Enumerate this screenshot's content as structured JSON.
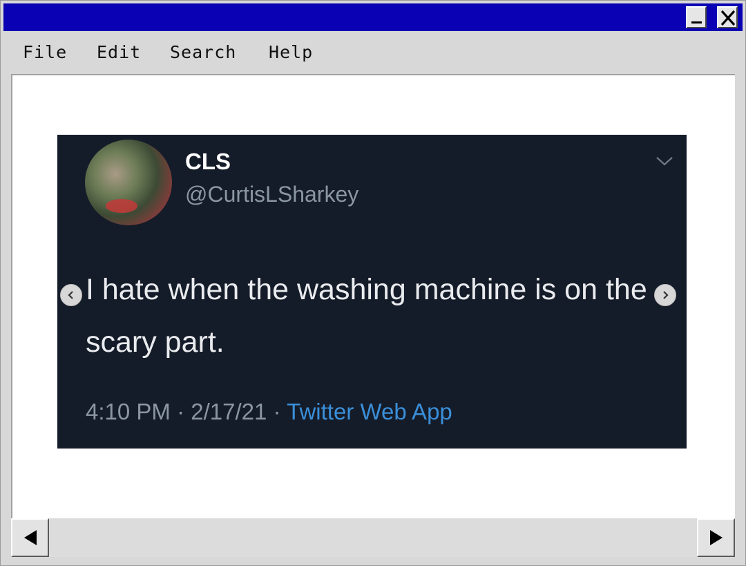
{
  "window": {
    "buttons": {
      "minimize_icon": "minimize-icon",
      "close_icon": "close-icon"
    }
  },
  "menu": {
    "items": [
      {
        "label": "File"
      },
      {
        "label": "Edit"
      },
      {
        "label": "Search"
      },
      {
        "label": "Help"
      }
    ]
  },
  "tweet": {
    "name": "CLS",
    "handle": "@CurtisLSharkey",
    "text": "I hate when the washing machine is on the scary part.",
    "time": "4:10 PM",
    "date": "2/17/21",
    "app": "Twitter Web App",
    "separator": "·"
  },
  "colors": {
    "titlebar": "#0a00b4",
    "tweet_background": "#151c29",
    "link": "#3a8fd9"
  }
}
